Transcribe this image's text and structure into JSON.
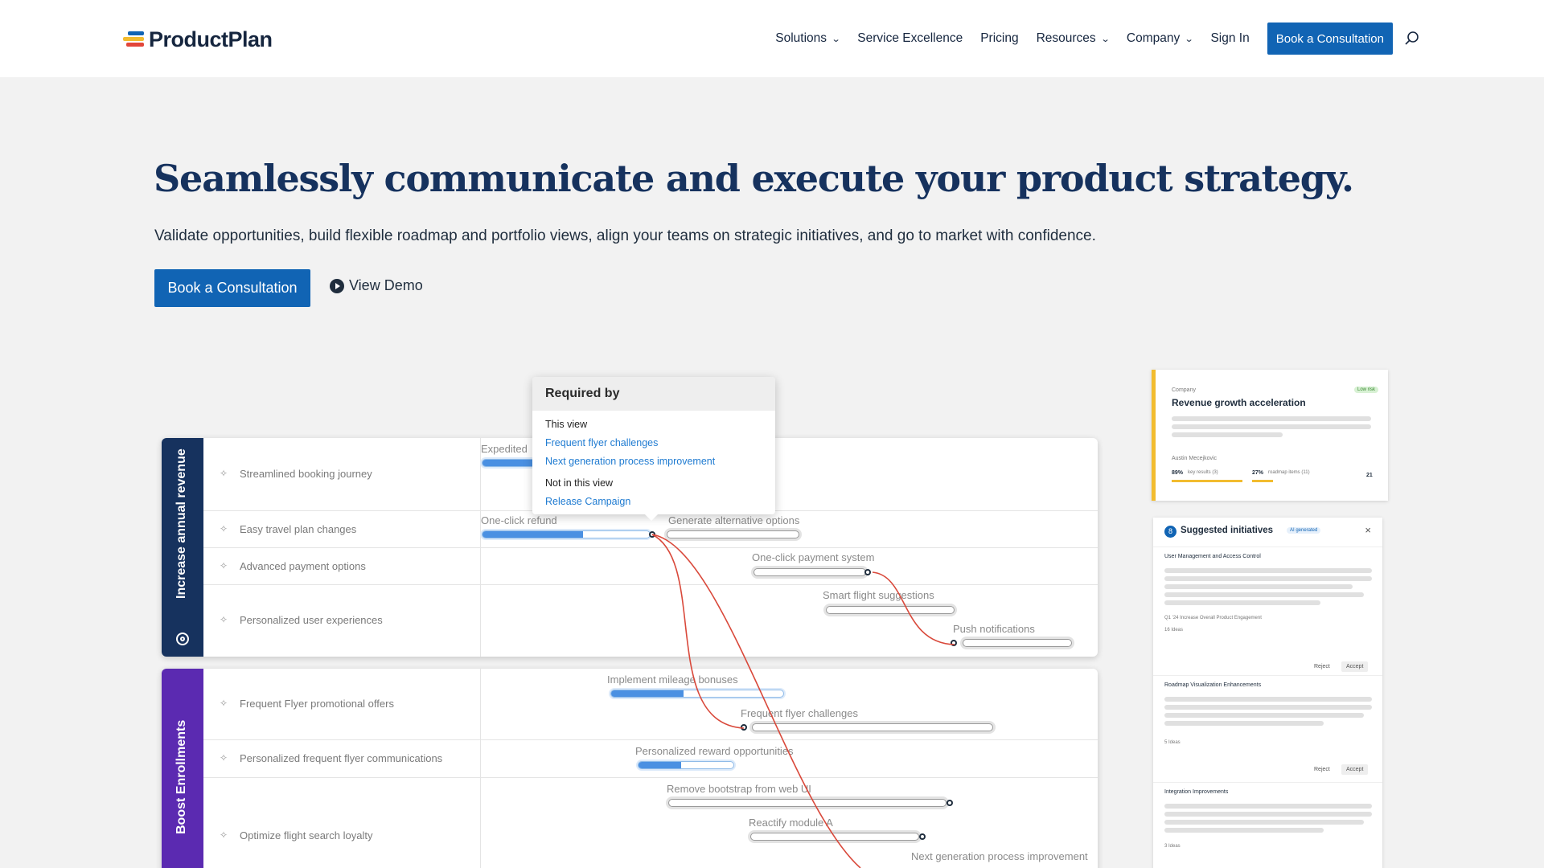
{
  "brand": {
    "name": "ProductPlan",
    "logo_colors": [
      "#f2bc2f",
      "#1164b4",
      "#e2463a"
    ]
  },
  "nav": {
    "items": [
      {
        "label": "Solutions",
        "dropdown": true
      },
      {
        "label": "Service Excellence",
        "dropdown": false
      },
      {
        "label": "Pricing",
        "dropdown": false
      },
      {
        "label": "Resources",
        "dropdown": true
      },
      {
        "label": "Company",
        "dropdown": true
      },
      {
        "label": "Sign In",
        "dropdown": false
      }
    ],
    "cta_label": "Book a Consultation",
    "search_icon": "search-icon"
  },
  "hero": {
    "title": "Seamlessly communicate and execute your product strategy.",
    "subtitle": "Validate opportunities, build flexible roadmap and portfolio views, align your teams on strategic initiatives, and go to market with confidence.",
    "cta_label": "Book a Consultation",
    "demo_label": "View Demo"
  },
  "roadmap": {
    "lane1": {
      "title": "Increase annual revenue",
      "color": "#16325e",
      "rows": [
        "Streamlined booking journey",
        "Easy travel plan changes",
        "Advanced payment options",
        "Personalized user experiences"
      ]
    },
    "lane2": {
      "title": "Boost Enrollments",
      "color": "#5b2ab1",
      "rows": [
        "Frequent Flyer promotional offers",
        "Personalized frequent flyer communications",
        "Optimize flight search loyalty"
      ]
    },
    "bars": {
      "expedited": "Expedited",
      "one_click_refund": "One-click refund",
      "generate_alt": "Generate alternative options",
      "one_click_payment": "One-click payment system",
      "smart_flight": "Smart flight suggestions",
      "push": "Push notifications",
      "mileage": "Implement mileage bonuses",
      "ff_challenges": "Frequent flyer challenges",
      "reward": "Personalized reward opportunities",
      "bootstrap": "Remove bootstrap from web UI",
      "reactify": "Reactify module A",
      "next_gen": "Next generation process improvement"
    },
    "progress": {
      "one_click_refund": 0.6,
      "mileage": 0.42,
      "reward": 0.45
    },
    "tooltip": {
      "title": "Required by",
      "this_view": "This view",
      "this_view_links": [
        "Frequent flyer challenges",
        "Next generation process improvement"
      ],
      "not_in_view": "Not in this view",
      "not_in_view_links": [
        "Release Campaign"
      ]
    },
    "dependency_color": "#d9493b"
  },
  "company_card": {
    "kicker": "Company",
    "title": "Revenue growth acceleration",
    "badge": "Low risk",
    "owner": "Austin Mecejkovic",
    "stat1": "89%",
    "stat1_label": "key results (3)",
    "stat2": "27%",
    "stat2_label": "roadmap items (11)",
    "count": "21"
  },
  "suggested": {
    "count": "8",
    "title": "Suggested initiatives",
    "tag": "AI generated",
    "close": "×",
    "items": [
      {
        "title": "User Management and Access Control",
        "goal": "Q1 '24  Increase Overall Product Engagement",
        "ideas": "16 Ideas"
      },
      {
        "title": "Roadmap Visualization Enhancements",
        "ideas": "5 Ideas"
      },
      {
        "title": "Integration Improvements",
        "ideas": "3 Ideas"
      }
    ],
    "reject": "Reject",
    "accept": "Accept"
  }
}
